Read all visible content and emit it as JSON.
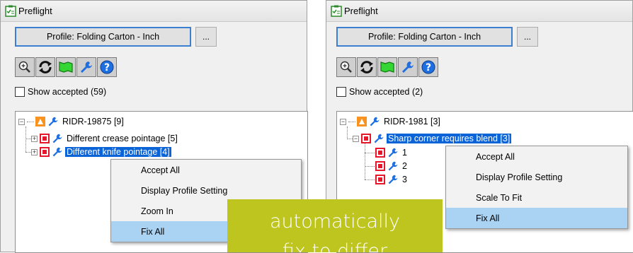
{
  "left_panel": {
    "title": "Preflight",
    "profile_button": "Profile: Folding Carton - Inch",
    "more_button": "...",
    "toolbar": [
      "zoom-icon",
      "refresh-icon",
      "fit-to-area-icon",
      "wrench-icon",
      "help-icon"
    ],
    "show_accepted": "Show accepted (59)",
    "tree": {
      "root": "RIDR-19875 [9]",
      "children": [
        "Different crease pointage [5]",
        "Different knife pointage [4]"
      ]
    },
    "context_menu": [
      "Accept All",
      "Display Profile Setting",
      "Zoom In",
      "Fix All"
    ]
  },
  "right_panel": {
    "title": "Preflight",
    "profile_button": "Profile: Folding Carton - Inch",
    "more_button": "...",
    "toolbar": [
      "zoom-icon",
      "refresh-icon",
      "fit-to-area-icon",
      "wrench-icon",
      "help-icon"
    ],
    "show_accepted": "Show accepted (2)",
    "tree": {
      "root": "RIDR-1981 [3]",
      "child": "Sharp corner requires blend [3]",
      "grandchildren": [
        "1",
        "2",
        "3"
      ]
    },
    "context_menu": [
      "Accept All",
      "Display Profile Setting",
      "Scale To Fit",
      "Fix All"
    ]
  },
  "caption": {
    "line1": "automatically",
    "line2": "fix to differ"
  },
  "colors": {
    "selection": "#0a64d8",
    "menu_hover": "#aad2f3",
    "caption_bg": "#bec51e",
    "error_red": "#e8162a",
    "warning_orange": "#f7931e"
  }
}
